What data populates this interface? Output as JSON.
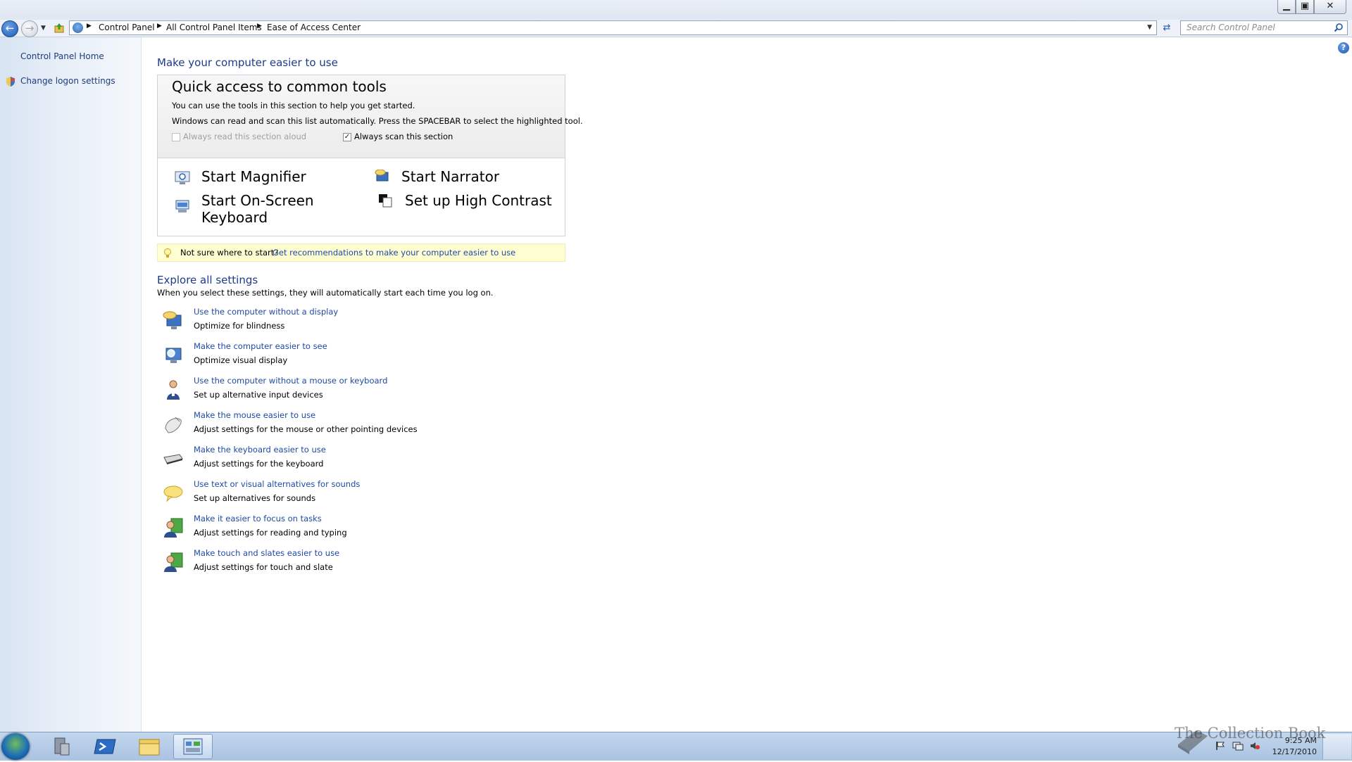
{
  "window": {
    "controls": {
      "minimize": "▁",
      "maximize": "▣",
      "close": "✕"
    }
  },
  "nav": {
    "breadcrumb": [
      "Control Panel",
      "All Control Panel Items",
      "Ease of Access Center"
    ],
    "search_placeholder": "Search Control Panel"
  },
  "sidebar": {
    "home": "Control Panel Home",
    "logon": "Change logon settings"
  },
  "main": {
    "heading": "Make your computer easier to use",
    "quick": {
      "title": "Quick access to common tools",
      "line1": "You can use the tools in this section to help you get started.",
      "line2": "Windows can read and scan this list automatically.  Press the SPACEBAR to select the highlighted tool.",
      "read_aloud": {
        "label": "Always read this section aloud",
        "checked": false
      },
      "scan": {
        "label": "Always scan this section",
        "checked": true
      },
      "tools": {
        "magnifier": "Start Magnifier",
        "narrator": "Start Narrator",
        "osk": "Start On-Screen Keyboard",
        "contrast": "Set up High Contrast"
      }
    },
    "tip": {
      "label": "Not sure where to start?",
      "link": "Get recommendations to make your computer easier to use"
    },
    "explore": {
      "heading": "Explore all settings",
      "subtitle": "When you select these settings, they will automatically start each time you log on.",
      "items": [
        {
          "link": "Use the computer without a display",
          "desc": "Optimize for blindness",
          "icon": "monitor-speaker-icon"
        },
        {
          "link": "Make the computer easier to see",
          "desc": "Optimize visual display",
          "icon": "monitor-magnify-icon"
        },
        {
          "link": "Use the computer without a mouse or keyboard",
          "desc": "Set up alternative input devices",
          "icon": "person-icon"
        },
        {
          "link": "Make the mouse easier to use",
          "desc": "Adjust settings for the mouse or other pointing devices",
          "icon": "mouse-icon"
        },
        {
          "link": "Make the keyboard easier to use",
          "desc": "Adjust settings for the keyboard",
          "icon": "keyboard-icon"
        },
        {
          "link": "Use text or visual alternatives for sounds",
          "desc": "Set up alternatives for sounds",
          "icon": "speech-bubble-icon"
        },
        {
          "link": "Make it easier to focus on tasks",
          "desc": "Adjust settings for reading and typing",
          "icon": "user-focus-icon"
        },
        {
          "link": "Make touch and slates easier to use",
          "desc": "Adjust settings for touch and slate",
          "icon": "user-touch-icon"
        }
      ]
    }
  },
  "taskbar": {
    "time": "9:25 AM",
    "date": "12/17/2010",
    "watermark": "The Collection Book"
  },
  "colors": {
    "link": "#1f4aa5",
    "heading": "#1e3a8a",
    "tip_bg": "#fffdd2"
  }
}
